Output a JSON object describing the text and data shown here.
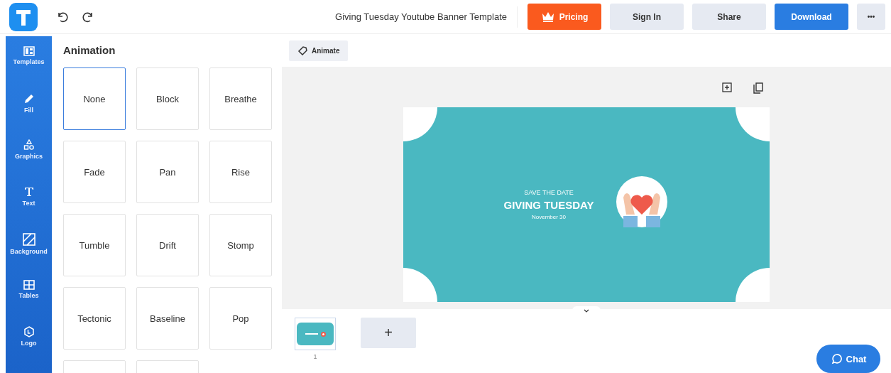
{
  "header": {
    "title": "Giving Tuesday Youtube Banner Template",
    "buttons": [
      {
        "label": "Pricing",
        "kind": "pricing"
      },
      {
        "label": "Sign In",
        "kind": "plain"
      },
      {
        "label": "Share",
        "kind": "plain"
      },
      {
        "label": "Download",
        "kind": "primary"
      },
      {
        "label": "•••",
        "kind": "more"
      }
    ]
  },
  "sidebar": {
    "items": [
      {
        "label": "Templates",
        "kind": "templates"
      },
      {
        "label": "Fill",
        "kind": "fill"
      },
      {
        "label": "Graphics",
        "kind": "graphics"
      },
      {
        "label": "Text",
        "kind": "text"
      },
      {
        "label": "Background",
        "kind": "background"
      },
      {
        "label": "Tables",
        "kind": "tables"
      },
      {
        "label": "Logo",
        "kind": "logo"
      }
    ]
  },
  "panel": {
    "title": "Animation",
    "options": [
      {
        "label": "None",
        "selected": true
      },
      {
        "label": "Block",
        "selected": false
      },
      {
        "label": "Breathe",
        "selected": false
      },
      {
        "label": "Fade",
        "selected": false
      },
      {
        "label": "Pan",
        "selected": false
      },
      {
        "label": "Rise",
        "selected": false
      },
      {
        "label": "Tumble",
        "selected": false
      },
      {
        "label": "Drift",
        "selected": false
      },
      {
        "label": "Stomp",
        "selected": false
      },
      {
        "label": "Tectonic",
        "selected": false
      },
      {
        "label": "Baseline",
        "selected": false
      },
      {
        "label": "Pop",
        "selected": false
      }
    ]
  },
  "toolbar": {
    "animate_label": "Animate"
  },
  "banner": {
    "eyebrow": "SAVE THE DATE",
    "headline": "GIVING TUESDAY",
    "date": "November 30"
  },
  "pages": {
    "thumbnails": [
      {
        "number": "1",
        "selected": true
      }
    ],
    "add_label": "+"
  },
  "chat": {
    "label": "Chat"
  }
}
